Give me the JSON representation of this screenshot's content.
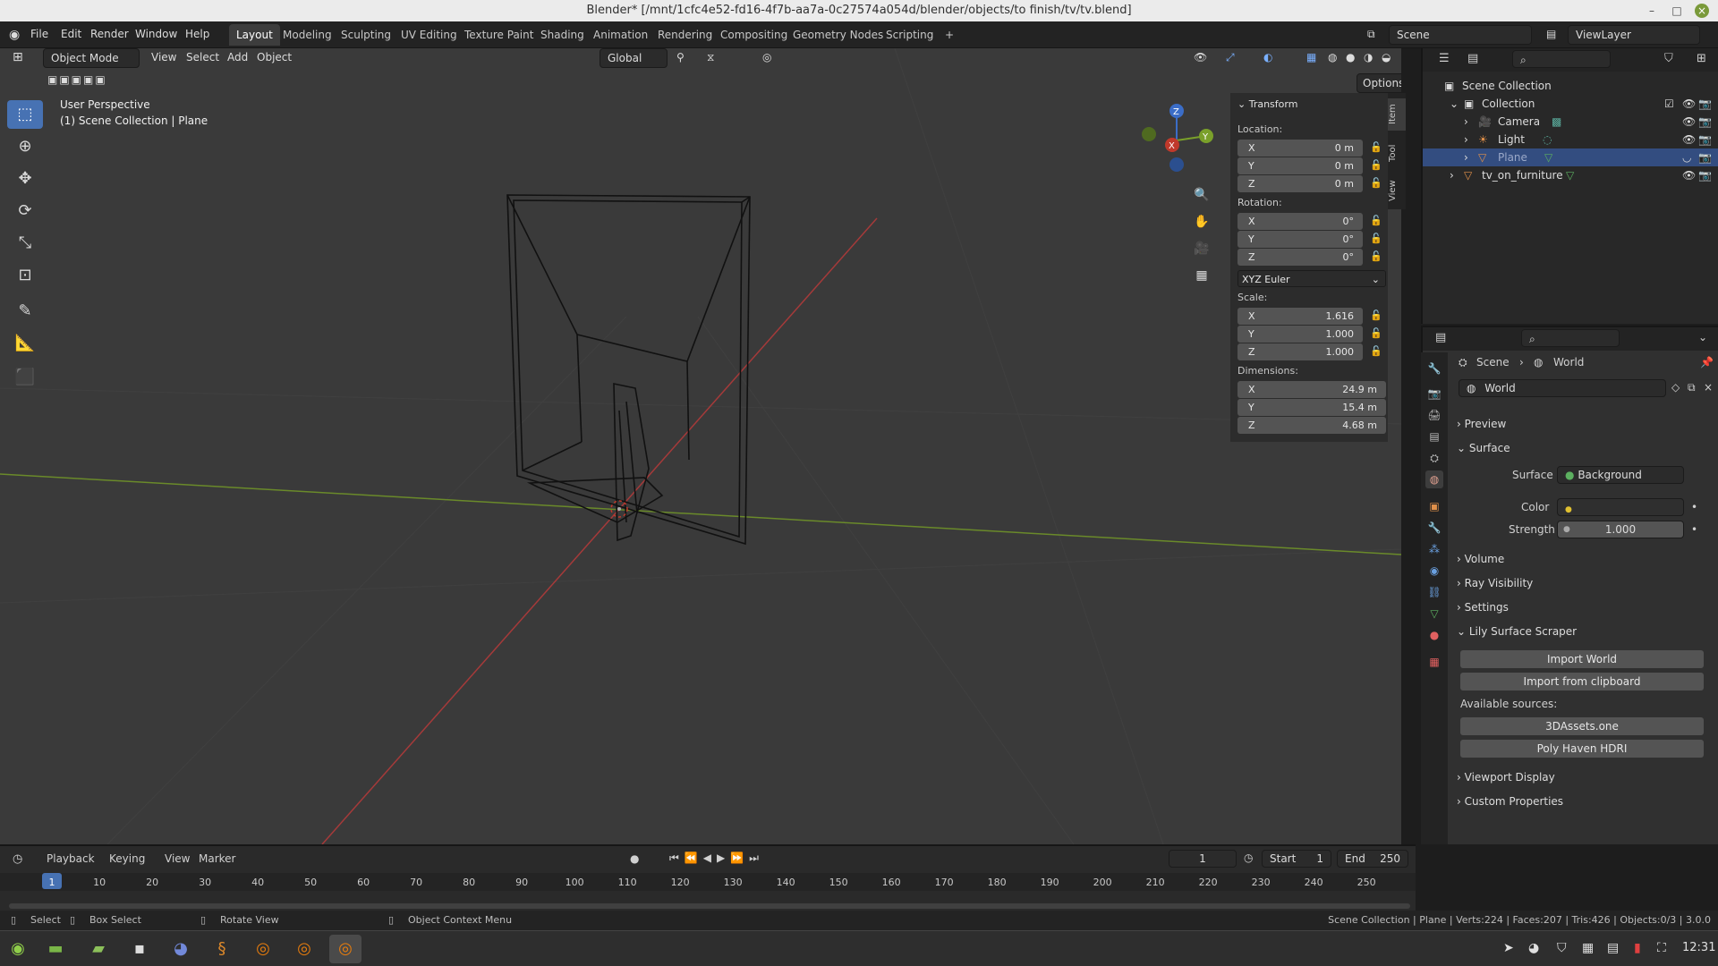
{
  "window": {
    "title": "Blender* [/mnt/1cfc4e52-fd16-4f7b-aa7a-0c27574a054d/blender/objects/to finish/tv/tv.blend]"
  },
  "menubar": {
    "menus": [
      "File",
      "Edit",
      "Render",
      "Window",
      "Help"
    ],
    "workspaces": [
      "Layout",
      "Modeling",
      "Sculpting",
      "UV Editing",
      "Texture Paint",
      "Shading",
      "Animation",
      "Rendering",
      "Compositing",
      "Geometry Nodes",
      "Scripting"
    ],
    "active_workspace": "Layout",
    "add_tab": "+",
    "scene": "Scene",
    "view_layer": "ViewLayer"
  },
  "viewport": {
    "mode": "Object Mode",
    "menus": [
      "View",
      "Select",
      "Add",
      "Object"
    ],
    "orientation": "Global",
    "options": "Options",
    "overlay_title": "User Perspective",
    "overlay_subtitle": "(1) Scene Collection | Plane"
  },
  "npanel": {
    "header": "Transform",
    "location_label": "Location:",
    "location": [
      {
        "axis": "X",
        "value": "0 m"
      },
      {
        "axis": "Y",
        "value": "0 m"
      },
      {
        "axis": "Z",
        "value": "0 m"
      }
    ],
    "rotation_label": "Rotation:",
    "rotation": [
      {
        "axis": "X",
        "value": "0°"
      },
      {
        "axis": "Y",
        "value": "0°"
      },
      {
        "axis": "Z",
        "value": "0°"
      }
    ],
    "rotation_mode": "XYZ Euler",
    "scale_label": "Scale:",
    "scale": [
      {
        "axis": "X",
        "value": "1.616"
      },
      {
        "axis": "Y",
        "value": "1.000"
      },
      {
        "axis": "Z",
        "value": "1.000"
      }
    ],
    "dimensions_label": "Dimensions:",
    "dimensions": [
      {
        "axis": "X",
        "value": "24.9 m"
      },
      {
        "axis": "Y",
        "value": "15.4 m"
      },
      {
        "axis": "Z",
        "value": "4.68 m"
      }
    ],
    "tabs": [
      "Item",
      "Tool",
      "View"
    ]
  },
  "outliner": {
    "root": "Scene Collection",
    "items": [
      {
        "name": "Collection",
        "selected": false
      },
      {
        "name": "Camera",
        "selected": false
      },
      {
        "name": "Light",
        "selected": false
      },
      {
        "name": "Plane",
        "selected": true
      },
      {
        "name": "tv_on_furniture",
        "selected": false
      }
    ]
  },
  "properties": {
    "breadcrumb_scene": "Scene",
    "breadcrumb_world": "World",
    "world_name": "World",
    "panels": {
      "preview": "Preview",
      "surface": "Surface",
      "surface_label": "Surface",
      "surface_value": "Background",
      "color_label": "Color",
      "strength_label": "Strength",
      "strength_value": "1.000",
      "volume": "Volume",
      "ray_visibility": "Ray Visibility",
      "settings": "Settings",
      "lily": "Lily Surface Scraper",
      "import_world": "Import World",
      "import_clipboard": "Import from clipboard",
      "available_sources": "Available sources:",
      "source1": "3DAssets.one",
      "source2": "Poly Haven HDRI",
      "viewport_display": "Viewport Display",
      "custom_properties": "Custom Properties"
    }
  },
  "timeline": {
    "menus": [
      "Playback",
      "Keying",
      "View",
      "Marker"
    ],
    "current_frame": "1",
    "start_label": "Start",
    "start": "1",
    "end_label": "End",
    "end": "250",
    "ticks": [
      "1",
      "10",
      "20",
      "30",
      "40",
      "50",
      "60",
      "70",
      "80",
      "90",
      "100",
      "110",
      "120",
      "130",
      "140",
      "150",
      "160",
      "170",
      "180",
      "190",
      "200",
      "210",
      "220",
      "230",
      "240",
      "250"
    ]
  },
  "statusbar": {
    "select": "Select",
    "box_select": "Box Select",
    "rotate_view": "Rotate View",
    "context_menu": "Object Context Menu",
    "stats": "Scene Collection | Plane | Verts:224 | Faces:207 | Tris:426 | Objects:0/3 | 3.0.0"
  },
  "taskbar": {
    "clock": "12:31"
  },
  "colors": {
    "accent": "#4772b3",
    "x_axis": "#c0392b",
    "y_axis": "#7aa02a",
    "z_axis": "#3b6dc7"
  }
}
